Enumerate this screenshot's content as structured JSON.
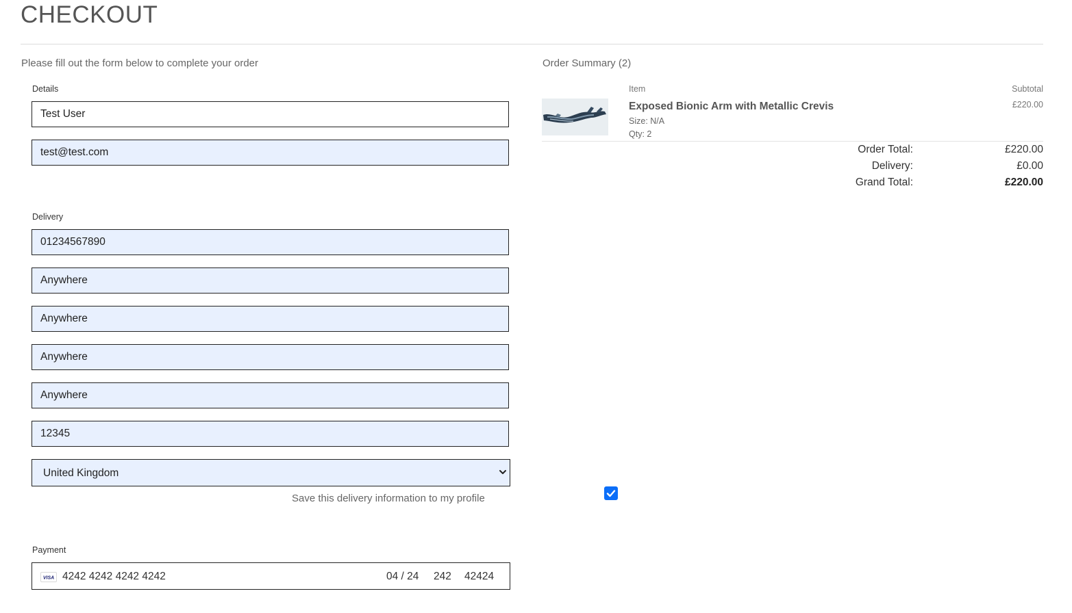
{
  "page": {
    "title": "CHECKOUT",
    "intro": "Please fill out the form below to complete your order"
  },
  "details": {
    "label": "Details",
    "full_name": "Test User",
    "email": "test@test.com"
  },
  "delivery": {
    "label": "Delivery",
    "phone": "01234567890",
    "address_line_1": "Anywhere",
    "address_line_2": "Anywhere",
    "town": "Anywhere",
    "county": "Anywhere",
    "postcode": "12345",
    "country": "United Kingdom",
    "save_info_label": "Save this delivery information to my profile",
    "save_info_checked": true
  },
  "payment": {
    "label": "Payment",
    "card_brand": "VISA",
    "card_number": "4242 4242 4242 4242",
    "expiry": "04 / 24",
    "cvc": "242",
    "zip": "42424"
  },
  "summary": {
    "title": "Order Summary (2)",
    "col_item": "Item",
    "col_subtotal": "Subtotal",
    "items": [
      {
        "name": "Exposed Bionic Arm with Metallic Crevis",
        "size": "Size: N/A",
        "qty": "Qty: 2",
        "subtotal": "£220.00"
      }
    ],
    "order_total_label": "Order Total:",
    "order_total": "£220.00",
    "delivery_label": "Delivery:",
    "delivery": "£0.00",
    "grand_total_label": "Grand Total:",
    "grand_total": "£220.00"
  },
  "colors": {
    "autofill_bg": "#e8f0fe",
    "checkbox_accent": "#0b6ef8"
  }
}
